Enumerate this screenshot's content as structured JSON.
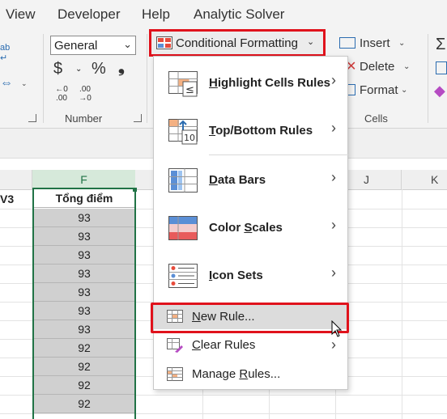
{
  "menubar": {
    "items": [
      "View",
      "Developer",
      "Help",
      "Analytic Solver"
    ]
  },
  "ribbon": {
    "number_group": {
      "format_value": "General",
      "currency_symbol": "$",
      "percent_symbol": "%",
      "comma_symbol": "❟",
      "increase_decimal_top": "←0",
      "increase_decimal_bottom": ".00",
      "decrease_decimal_top": ".00",
      "decrease_decimal_bottom": "→0",
      "label": "Number"
    },
    "conditional_formatting_label": "Conditional Formatting",
    "cells_group": {
      "insert_label": "Insert",
      "delete_label": "Delete",
      "format_label": "Format",
      "label": "Cells"
    }
  },
  "sheet": {
    "columns": {
      "f": "F",
      "j": "J",
      "k": "K"
    },
    "partial_header": "V3",
    "column_f_header": "Tổng điểm",
    "column_f_values": [
      "93",
      "93",
      "93",
      "93",
      "93",
      "93",
      "93",
      "92",
      "92",
      "92",
      "92"
    ]
  },
  "cf_menu": {
    "highlight": {
      "pre": "",
      "accel": "H",
      "post": "ighlight Cells Rules"
    },
    "topbottom": {
      "pre": "",
      "accel": "T",
      "post": "op/Bottom Rules"
    },
    "databars": {
      "pre": "",
      "accel": "D",
      "post": "ata Bars"
    },
    "colorscales": {
      "pre": "Color ",
      "accel": "S",
      "post": "cales"
    },
    "iconsets": {
      "pre": "",
      "accel": "I",
      "post": "con Sets"
    },
    "newrule": {
      "pre": "",
      "accel": "N",
      "post": "ew Rule..."
    },
    "clearrules": {
      "pre": "",
      "accel": "C",
      "post": "lear Rules"
    },
    "managerules": {
      "pre": "Manage ",
      "accel": "R",
      "post": "ules..."
    },
    "topbottom_icon_number": "10",
    "highlight_icon_symbol": "≤"
  },
  "colors": {
    "highlight_red": "#e0121c",
    "excel_green": "#217346",
    "selected_fill": "#d0d0d0"
  }
}
